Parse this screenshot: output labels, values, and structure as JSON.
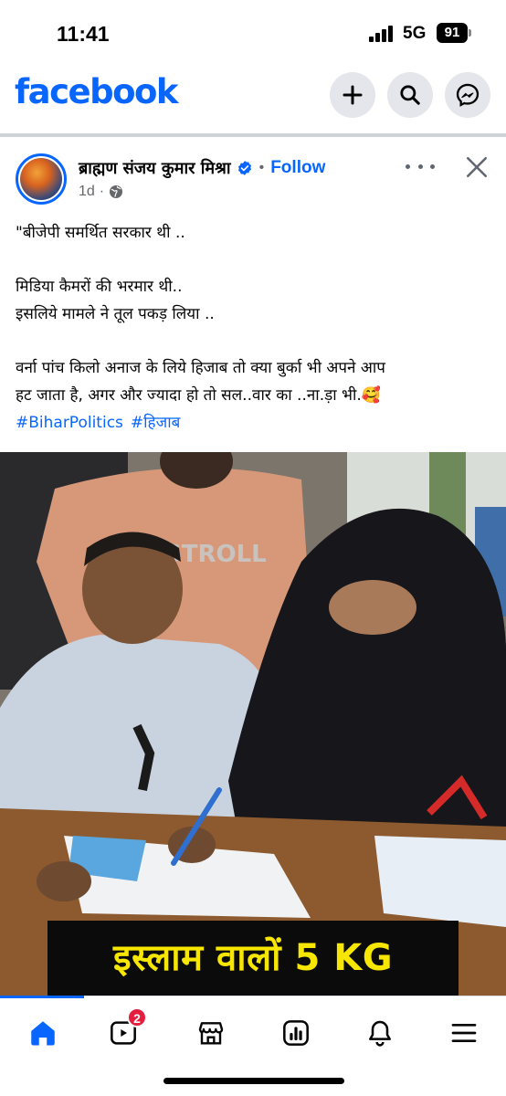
{
  "status_bar": {
    "time": "11:41",
    "network": "5G",
    "battery": "91"
  },
  "header": {
    "logo": "facebook",
    "brand_color": "#0866ff",
    "actions": [
      {
        "icon": "plus-icon"
      },
      {
        "icon": "search-icon"
      },
      {
        "icon": "messenger-icon"
      }
    ]
  },
  "post": {
    "author": "ब्राह्मण संजय कुमार मिश्रा",
    "verified_icon": "verified-badge-icon",
    "separator": "•",
    "follow_label": "Follow",
    "time": "1d",
    "meta_separator": "·",
    "audience_icon": "globe-icon",
    "text": {
      "line1": "\"बीजेपी समर्थित सरकार थी ..",
      "line2": "मिडिया कैमरों की भरमार थी..",
      "line3": "इसलिये मामले ने तूल पकड़ लिया ..",
      "line4": "वर्ना पांच किलो अनाज के लिये हिजाब तो क्या बुर्का भी अपने आप",
      "line5": "हट जाता है, अगर और ज्यादा हो तो सल..वार का ..ना.ड़ा भी.🥰"
    },
    "hashtags": [
      "#BiharPolitics",
      "#हिजाब"
    ],
    "image": {
      "caption": "इस्लाम वालों 5 KG",
      "caption_color": "#f7e600"
    }
  },
  "bottom_nav": {
    "items": [
      {
        "icon": "home-icon",
        "active": true
      },
      {
        "icon": "video-icon",
        "badge": "2"
      },
      {
        "icon": "marketplace-icon"
      },
      {
        "icon": "dashboard-icon"
      },
      {
        "icon": "bell-icon"
      },
      {
        "icon": "menu-icon"
      }
    ]
  }
}
